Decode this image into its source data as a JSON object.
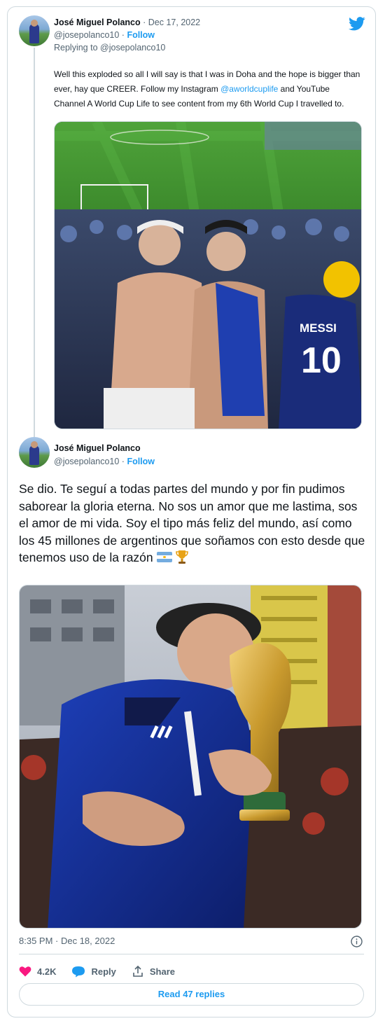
{
  "reply_tweet": {
    "author_name": "José Miguel Polanco",
    "date": "Dec 17, 2022",
    "handle": "@josepolanco10",
    "follow_label": "Follow",
    "replying_to_prefix": "Replying to",
    "replying_to_handle": "@josepolanco10",
    "text_part1": "Well this exploded so all I will say is that I was in Doha and the hope is bigger than ever, hay que CREER. Follow my Instagram",
    "mention": "@aworldcuplife",
    "text_part2": "and YouTube Channel A World Cup Life to see content from my 6th World Cup I travelled to.",
    "photo": {
      "jersey_name": "MESSI",
      "jersey_number": "10"
    }
  },
  "main_tweet": {
    "author_name": "José Miguel Polanco",
    "handle": "@josepolanco10",
    "follow_label": "Follow",
    "text": "Se dio. Te seguí a todas partes del mundo y por fin pudimos saborear la gloria eterna. No sos un amor que me lastima, sos el amor de mi vida. Soy el tipo más feliz del mundo, así como los 45 millones de argentinos que soñamos con esto desde que tenemos uso de la razón",
    "timestamp": "8:35 PM · Dec 18, 2022",
    "likes": "4.2K",
    "reply_label": "Reply",
    "share_label": "Share",
    "read_replies_label": "Read 47 replies"
  },
  "colors": {
    "accent": "#1d9bf0",
    "like": "#f91880",
    "border": "#cfd9de",
    "muted_text": "#536471"
  },
  "icons": [
    "twitter-bird-icon",
    "info-icon",
    "heart-icon",
    "reply-bubble-icon",
    "share-icon",
    "argentina-flag-icon",
    "trophy-icon"
  ]
}
